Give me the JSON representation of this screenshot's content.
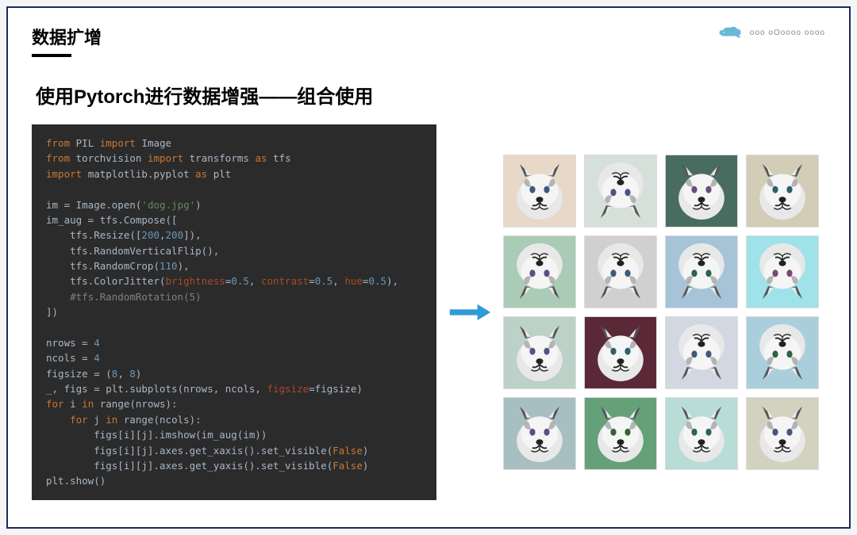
{
  "header": {
    "title": "数据扩增",
    "logo_text": "ooo oOoooo oooo"
  },
  "subtitle": "使用Pytorch进行数据增强——组合使用",
  "code": {
    "lines": [
      {
        "tokens": [
          {
            "t": "from ",
            "c": "tk-kw"
          },
          {
            "t": "PIL ",
            "c": "tk-mod"
          },
          {
            "t": "import ",
            "c": "tk-kw"
          },
          {
            "t": "Image",
            "c": "tk-mod"
          }
        ]
      },
      {
        "tokens": [
          {
            "t": "from ",
            "c": "tk-kw"
          },
          {
            "t": "torchvision ",
            "c": "tk-mod"
          },
          {
            "t": "import ",
            "c": "tk-kw"
          },
          {
            "t": "transforms ",
            "c": "tk-mod"
          },
          {
            "t": "as ",
            "c": "tk-kw"
          },
          {
            "t": "tfs",
            "c": "tk-mod"
          }
        ]
      },
      {
        "tokens": [
          {
            "t": "import ",
            "c": "tk-kw"
          },
          {
            "t": "matplotlib.pyplot ",
            "c": "tk-mod"
          },
          {
            "t": "as ",
            "c": "tk-kw"
          },
          {
            "t": "plt",
            "c": "tk-mod"
          }
        ]
      },
      {
        "tokens": [
          {
            "t": "",
            "c": ""
          }
        ]
      },
      {
        "tokens": [
          {
            "t": "im = Image.open(",
            "c": "tk-fn"
          },
          {
            "t": "'dog.jpg'",
            "c": "tk-str"
          },
          {
            "t": ")",
            "c": "tk-fn"
          }
        ]
      },
      {
        "tokens": [
          {
            "t": "im_aug = tfs.Compose([",
            "c": "tk-fn"
          }
        ]
      },
      {
        "tokens": [
          {
            "t": "    tfs.Resize([",
            "c": "tk-fn"
          },
          {
            "t": "200",
            "c": "tk-num"
          },
          {
            "t": ",",
            "c": "tk-fn"
          },
          {
            "t": "200",
            "c": "tk-num"
          },
          {
            "t": "]),",
            "c": "tk-fn"
          }
        ]
      },
      {
        "tokens": [
          {
            "t": "    tfs.RandomVerticalFlip(),",
            "c": "tk-fn"
          }
        ]
      },
      {
        "tokens": [
          {
            "t": "    tfs.RandomCrop(",
            "c": "tk-fn"
          },
          {
            "t": "110",
            "c": "tk-num"
          },
          {
            "t": "),",
            "c": "tk-fn"
          }
        ]
      },
      {
        "tokens": [
          {
            "t": "    tfs.ColorJitter(",
            "c": "tk-fn"
          },
          {
            "t": "brightness",
            "c": "tk-param"
          },
          {
            "t": "=",
            "c": "tk-fn"
          },
          {
            "t": "0.5",
            "c": "tk-num"
          },
          {
            "t": ", ",
            "c": "tk-fn"
          },
          {
            "t": "contrast",
            "c": "tk-param"
          },
          {
            "t": "=",
            "c": "tk-fn"
          },
          {
            "t": "0.5",
            "c": "tk-num"
          },
          {
            "t": ", ",
            "c": "tk-fn"
          },
          {
            "t": "hue",
            "c": "tk-param"
          },
          {
            "t": "=",
            "c": "tk-fn"
          },
          {
            "t": "0.5",
            "c": "tk-num"
          },
          {
            "t": "),",
            "c": "tk-fn"
          }
        ]
      },
      {
        "tokens": [
          {
            "t": "    #tfs.RandomRotation(5)",
            "c": "tk-comment"
          }
        ]
      },
      {
        "tokens": [
          {
            "t": "])",
            "c": "tk-fn"
          }
        ]
      },
      {
        "tokens": [
          {
            "t": "",
            "c": ""
          }
        ]
      },
      {
        "tokens": [
          {
            "t": "nrows = ",
            "c": "tk-fn"
          },
          {
            "t": "4",
            "c": "tk-num"
          }
        ]
      },
      {
        "tokens": [
          {
            "t": "ncols = ",
            "c": "tk-fn"
          },
          {
            "t": "4",
            "c": "tk-num"
          }
        ]
      },
      {
        "tokens": [
          {
            "t": "figsize = (",
            "c": "tk-fn"
          },
          {
            "t": "8",
            "c": "tk-num"
          },
          {
            "t": ", ",
            "c": "tk-fn"
          },
          {
            "t": "8",
            "c": "tk-num"
          },
          {
            "t": ")",
            "c": "tk-fn"
          }
        ]
      },
      {
        "tokens": [
          {
            "t": "_, figs = plt.subplots(nrows, ncols, ",
            "c": "tk-fn"
          },
          {
            "t": "figsize",
            "c": "tk-param"
          },
          {
            "t": "=figsize)",
            "c": "tk-fn"
          }
        ]
      },
      {
        "tokens": [
          {
            "t": "for ",
            "c": "tk-kw"
          },
          {
            "t": "i ",
            "c": "tk-fn"
          },
          {
            "t": "in ",
            "c": "tk-kw"
          },
          {
            "t": "range(nrows):",
            "c": "tk-fn"
          }
        ]
      },
      {
        "tokens": [
          {
            "t": "    for ",
            "c": "tk-kw"
          },
          {
            "t": "j ",
            "c": "tk-fn"
          },
          {
            "t": "in ",
            "c": "tk-kw"
          },
          {
            "t": "range(ncols):",
            "c": "tk-fn"
          }
        ]
      },
      {
        "tokens": [
          {
            "t": "        figs[i][j].imshow(im_aug(im))",
            "c": "tk-fn"
          }
        ]
      },
      {
        "tokens": [
          {
            "t": "        figs[i][j].axes.get_xaxis().set_visible(",
            "c": "tk-fn"
          },
          {
            "t": "False",
            "c": "tk-bool"
          },
          {
            "t": ")",
            "c": "tk-fn"
          }
        ]
      },
      {
        "tokens": [
          {
            "t": "        figs[i][j].axes.get_yaxis().set_visible(",
            "c": "tk-fn"
          },
          {
            "t": "False",
            "c": "tk-bool"
          },
          {
            "t": ")",
            "c": "tk-fn"
          }
        ]
      },
      {
        "tokens": [
          {
            "t": "plt.show()",
            "c": "tk-fn"
          }
        ]
      }
    ]
  },
  "grid": {
    "rows": 4,
    "cols": 4,
    "cells": [
      {
        "bg": "#e8d8c8",
        "flip": false,
        "hue": 0
      },
      {
        "bg": "#d8e0d8",
        "flip": true,
        "hue": 20
      },
      {
        "bg": "#5a6a4a",
        "flip": false,
        "hue": 60
      },
      {
        "bg": "#c8d0b8",
        "flip": false,
        "hue": -30
      },
      {
        "bg": "#b8c8a8",
        "flip": true,
        "hue": 40
      },
      {
        "bg": "#d0d0d0",
        "flip": true,
        "hue": 0
      },
      {
        "bg": "#c8b8e0",
        "flip": true,
        "hue": -60
      },
      {
        "bg": "#c0e0a0",
        "flip": true,
        "hue": 90
      },
      {
        "bg": "#c0d0c0",
        "flip": false,
        "hue": 30
      },
      {
        "bg": "#5a2a2a",
        "flip": false,
        "hue": -20
      },
      {
        "bg": "#d0d8e0",
        "flip": true,
        "hue": 10
      },
      {
        "bg": "#d8c0e8",
        "flip": true,
        "hue": -80
      },
      {
        "bg": "#a8c0b0",
        "flip": false,
        "hue": 50
      },
      {
        "bg": "#8090c0",
        "flip": false,
        "hue": -100
      },
      {
        "bg": "#c0d8e8",
        "flip": false,
        "hue": -40
      },
      {
        "bg": "#d8d0c0",
        "flip": false,
        "hue": 15
      }
    ]
  }
}
